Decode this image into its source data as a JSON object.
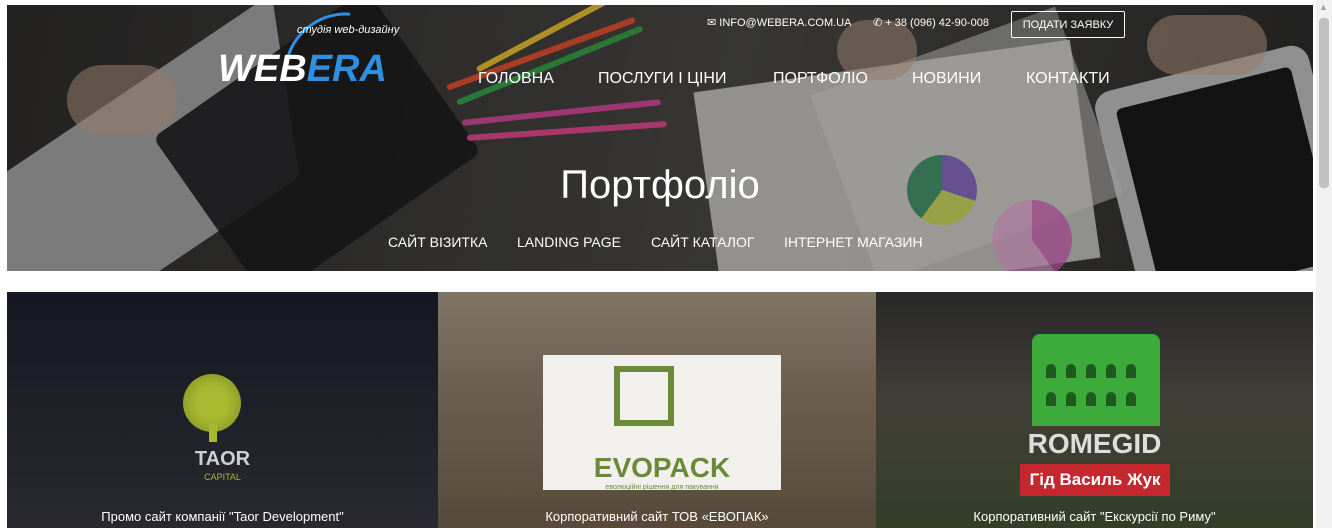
{
  "brand": {
    "logo_web": "WEB",
    "logo_era": "ERA",
    "tagline": "студія web-дизайну"
  },
  "contacts": {
    "email": "INFO@WEBERA.COM.UA",
    "phone": "+ 38 (096) 42-90-008",
    "apply_label": "ПОДАТИ ЗАЯВКУ"
  },
  "nav": {
    "items": [
      {
        "label": "ГОЛОВНА"
      },
      {
        "label": "ПОСЛУГИ І ЦІНИ"
      },
      {
        "label": "ПОРТФОЛІО"
      },
      {
        "label": "НОВИНИ"
      },
      {
        "label": "КОНТАКТИ"
      }
    ]
  },
  "hero": {
    "title": "Портфоліо"
  },
  "filters": {
    "items": [
      {
        "label": "САЙТ ВІЗИТКА"
      },
      {
        "label": "LANDING PAGE"
      },
      {
        "label": "САЙТ КАТАЛОГ"
      },
      {
        "label": "ІНТЕРНЕТ МАГАЗИН"
      }
    ]
  },
  "portfolio": {
    "items": [
      {
        "logo_title": "TAOR",
        "logo_sub": "CAPITAL",
        "caption": "Промо сайт компанії \"Taor Development\""
      },
      {
        "logo_title": "EVOPACK",
        "logo_sub": "еволюційні рішення для пакування",
        "caption": "Корпоративний сайт ТОВ «ЕВОПАК»"
      },
      {
        "logo_title": "ROMEGID",
        "logo_sub": "Гід Василь Жук",
        "caption": "Корпоративний сайт \"Екскурсії по Риму\""
      }
    ]
  },
  "icons": {
    "email": "envelope-icon",
    "phone": "phone-icon",
    "scroll_up": "arrow-up-icon"
  },
  "colors": {
    "accent": "#2f8fe0",
    "taor": "#a8b830",
    "evopack": "#6a8a3a",
    "romegid_green": "#3cab3c",
    "romegid_red": "#c4282e"
  }
}
